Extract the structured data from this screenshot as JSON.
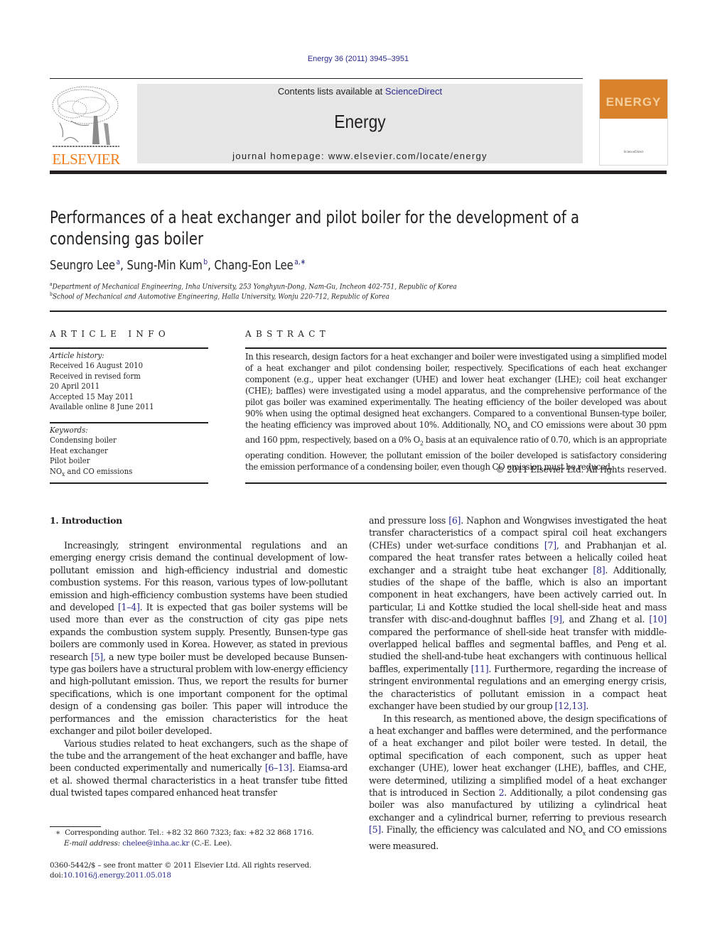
{
  "header": {
    "citation": "Energy 36 (2011) 3945–3951",
    "contents_prefix": "Contents lists available at ",
    "contents_link": "ScienceDirect",
    "journal_name": "Energy",
    "homepage": "journal homepage: www.elsevier.com/locate/energy",
    "publisher_logo_text": "ELSEVIER",
    "cover_title": "ENERGY",
    "cover_footer": "ScienceDirect",
    "colors": {
      "publisher_orange": "#f07c1c",
      "link_blue": "#2a2a8c",
      "masthead_gray": "#e6e6e6",
      "cover_orange": "#d9822b"
    }
  },
  "article": {
    "title": "Performances of a heat exchanger and pilot boiler for the development of a condensing gas boiler",
    "authors": [
      {
        "name": "Seungro Lee",
        "sup": "a"
      },
      {
        "name": "Sung-Min Kum",
        "sup": "b"
      },
      {
        "name": "Chang-Eon Lee",
        "sup": "a,∗"
      }
    ],
    "affiliations": [
      {
        "label": "a",
        "text": "Department of Mechanical Engineering, Inha University, 253 Yonghyun-Dong, Nam-Gu, Incheon 402-751, Republic of Korea"
      },
      {
        "label": "b",
        "text": "School of Mechanical and Automotive Engineering, Halla University, Wonju 220-712, Republic of Korea"
      }
    ]
  },
  "article_info": {
    "heading": "ARTICLE INFO",
    "history_label": "Article history:",
    "history": [
      "Received 16 August 2010",
      "Received in revised form",
      "20 April 2011",
      "Accepted 15 May 2011",
      "Available online 8 June 2011"
    ],
    "keywords_label": "Keywords:",
    "keywords": [
      "Condensing boiler",
      "Heat exchanger",
      "Pilot boiler"
    ],
    "keyword_last_prefix": "NO",
    "keyword_last_sub": "x",
    "keyword_last_suffix": " and CO emissions"
  },
  "abstract": {
    "heading": "ABSTRACT",
    "part1": "In this research, design factors for a heat exchanger and boiler were investigated using a simplified model of a heat exchanger and pilot condensing boiler, respectively. Specifications of each heat exchanger component (e.g., upper heat exchanger (UHE) and lower heat exchanger (LHE); coil heat exchanger (CHE); baffles) were investigated using a model apparatus, and the comprehensive performance of the pilot gas boiler was examined experimentally. The heating efficiency of the boiler developed was about 90% when using the optimal designed heat exchangers. Compared to a conventional Bunsen-type boiler, the heating efficiency was improved about 10%. Additionally, NO",
    "sub1": "x",
    "part2": " and CO emissions were about 30 ppm and 160 ppm, respectively, based on a 0% O",
    "sub2": "2",
    "part3": " basis at an equivalence ratio of 0.70, which is an appropriate operating condition. However, the pollutant emission of the boiler developed is satisfactory considering the emission performance of a condensing boiler, even though CO emission must be reduced.",
    "copyright": "© 2011 Elsevier Ltd. All rights reserved."
  },
  "body": {
    "section_heading": "1.  Introduction",
    "p1_a": "Increasingly, stringent environmental regulations and an emerging energy crisis demand the continual development of low-pollutant emission and high-efficiency industrial and domestic combustion systems. For this reason, various types of low-pollutant emission and high-efficiency combustion systems have been studied and developed ",
    "p1_ref1": "[1–4]",
    "p1_b": ". It is expected that gas boiler systems will be used more than ever as the construction of city gas pipe nets expands the combustion system supply. Presently, Bunsen-type gas boilers are commonly used in Korea. However, as stated in previous research ",
    "p1_ref2": "[5]",
    "p1_c": ", a new type boiler must be developed because Bunsen-type gas boilers have a structural problem with low-energy efficiency and high-pollutant emission. Thus, we report the results for burner specifications, which is one important component for the optimal design of a condensing gas boiler. This paper will introduce the performances and the emission characteristics for the heat exchanger and pilot boiler developed.",
    "p2_a": "Various studies related to heat exchangers, such as the shape of the tube and the arrangement of the heat exchanger and baffle, have been conducted experimentally and numerically ",
    "p2_ref1": "[6–13]",
    "p2_b": ". Eiamsa-ard et al. showed thermal characteristics in a heat transfer tube fitted dual twisted tapes compared enhanced heat transfer and pressure loss ",
    "p2_ref2": "[6]",
    "p2_c": ". Naphon and Wongwises investigated the heat transfer characteristics of a compact spiral coil heat exchangers (CHEs) under wet-surface conditions ",
    "p2_ref3": "[7]",
    "p2_d": ", and Prabhanjan et al. compared the heat transfer rates between a helically coiled heat exchanger and a straight tube heat exchanger ",
    "p2_ref4": "[8]",
    "p2_e": ". Additionally, studies of the shape of the baffle, which is also an important component in heat exchangers, have been actively carried out. In particular, Li and Kottke studied the local shell-side heat and mass transfer with disc-and-doughnut baffles ",
    "p2_ref5": "[9]",
    "p2_f": ", and Zhang et al. ",
    "p2_ref6": "[10]",
    "p2_g": " compared the performance of shell-side heat transfer with middle-overlapped helical baffles and segmental baffles, and Peng et al. studied the shell-and-tube heat exchangers with continuous hellical baffles, experimentally ",
    "p2_ref7": "[11]",
    "p2_h": ". Furthermore, regarding the increase of stringent environmental regulations and an emerging energy crisis, the characteristics of pollutant emission in a compact heat exchanger have been studied by our group ",
    "p2_ref8": "[12,13]",
    "p2_i": ".",
    "p3_a": "In this research, as mentioned above, the design specifications of a heat exchanger and baffles were determined, and the performance of a heat exchanger and pilot boiler were tested. In detail, the optimal specification of each component, such as upper heat exchanger (UHE), lower heat exchanger (LHE), baffles, and CHE, were determined, utilizing a simplified model of a heat exchanger that is introduced in Section ",
    "p3_ref1": "2",
    "p3_b": ". Additionally, a pilot condensing gas boiler was also manufactured by utilizing a cylindrical heat exchanger and a cylindrical burner, referring to previous research ",
    "p3_ref2": "[5]",
    "p3_c": ". Finally, the efficiency was calculated and NO",
    "p3_sub": "x",
    "p3_d": " and CO emissions were measured."
  },
  "footnotes": {
    "star": "∗",
    "corresponding": "Corresponding author. Tel.: +82 32 860 7323; fax: +82 32 868 1716.",
    "email_label": "E-mail address:",
    "email": "chelee@inha.ac.kr",
    "email_suffix": " (C.-E. Lee).",
    "front_matter": "0360-5442/$ – see front matter © 2011 Elsevier Ltd. All rights reserved.",
    "doi_label": "doi:",
    "doi": "10.1016/j.energy.2011.05.018"
  }
}
